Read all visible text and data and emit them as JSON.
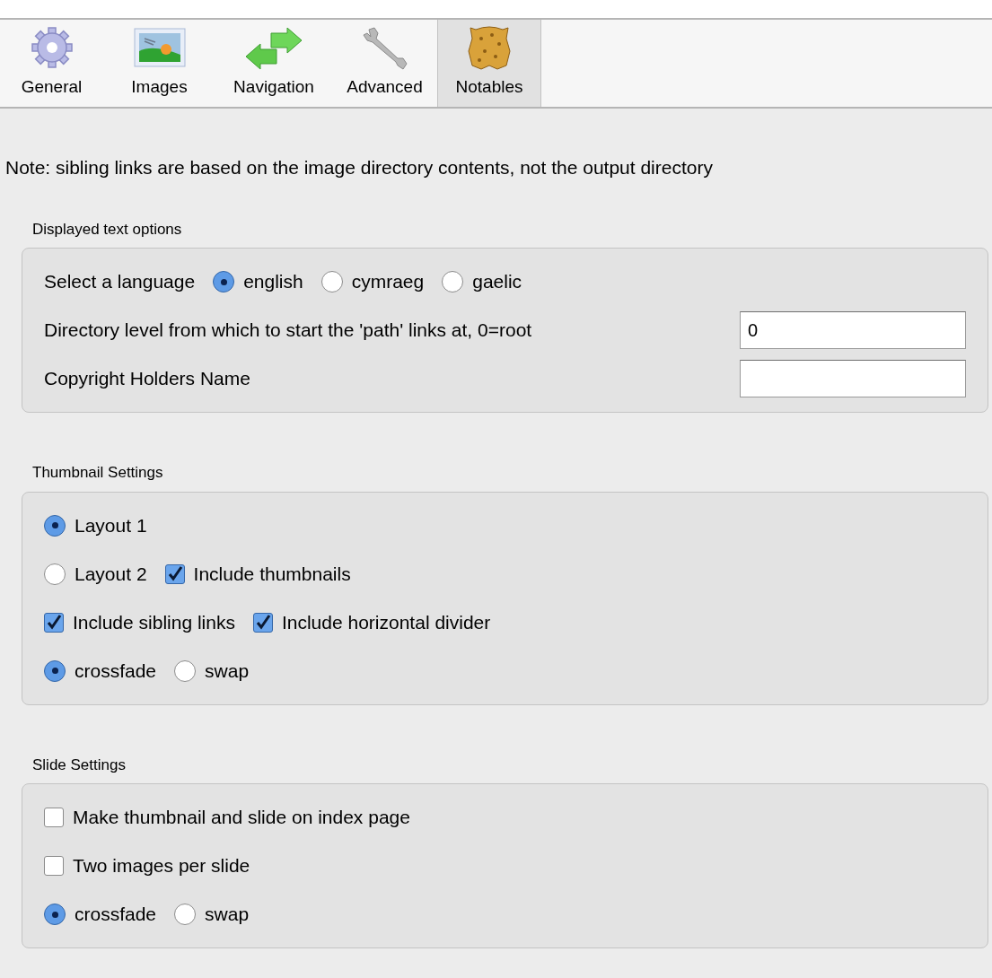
{
  "toolbar": [
    {
      "label": "General",
      "selected": false
    },
    {
      "label": "Images",
      "selected": false
    },
    {
      "label": "Navigation",
      "selected": false
    },
    {
      "label": "Advanced",
      "selected": false
    },
    {
      "label": "Notables",
      "selected": true
    }
  ],
  "note": "Note: sibling links are based on the image directory contents, not the output directory",
  "sections": [
    {
      "title": "Displayed text options",
      "rows": [
        [
          {
            "kind": "label",
            "label": "Select a language"
          },
          {
            "kind": "radio",
            "label": "english",
            "selected": true
          },
          {
            "kind": "radio",
            "label": "cymraeg",
            "selected": false
          },
          {
            "kind": "radio",
            "label": "gaelic",
            "selected": false
          }
        ],
        [
          {
            "kind": "label",
            "label": "Directory level from which to start the 'path' links at, 0=root"
          },
          {
            "kind": "field",
            "value": "0"
          }
        ],
        [
          {
            "kind": "label",
            "label": "Copyright Holders Name"
          },
          {
            "kind": "field"
          }
        ]
      ]
    },
    {
      "title": "Thumbnail Settings",
      "rows": [
        [
          {
            "kind": "radio",
            "label": "Layout 1",
            "selected": true
          }
        ],
        [
          {
            "kind": "radio",
            "label": "Layout 2",
            "selected": false
          },
          {
            "kind": "checkbox",
            "label": "Include thumbnails",
            "checked": true
          }
        ],
        [
          {
            "kind": "checkbox",
            "label": "Include sibling links",
            "checked": true
          },
          {
            "kind": "checkbox",
            "label": "Include horizontal divider",
            "checked": true
          }
        ],
        [
          {
            "kind": "radio",
            "label": "crossfade",
            "selected": true
          },
          {
            "kind": "radio",
            "label": "swap",
            "selected": false
          }
        ]
      ]
    },
    {
      "title": "Slide Settings",
      "rows": [
        [
          {
            "kind": "checkbox",
            "label": "Make thumbnail and slide on index page",
            "checked": false
          }
        ],
        [
          {
            "kind": "checkbox",
            "label": "Two images per slide",
            "checked": false
          }
        ],
        [
          {
            "kind": "radio",
            "label": "crossfade",
            "selected": true
          },
          {
            "kind": "radio",
            "label": "swap",
            "selected": false
          }
        ]
      ]
    }
  ]
}
